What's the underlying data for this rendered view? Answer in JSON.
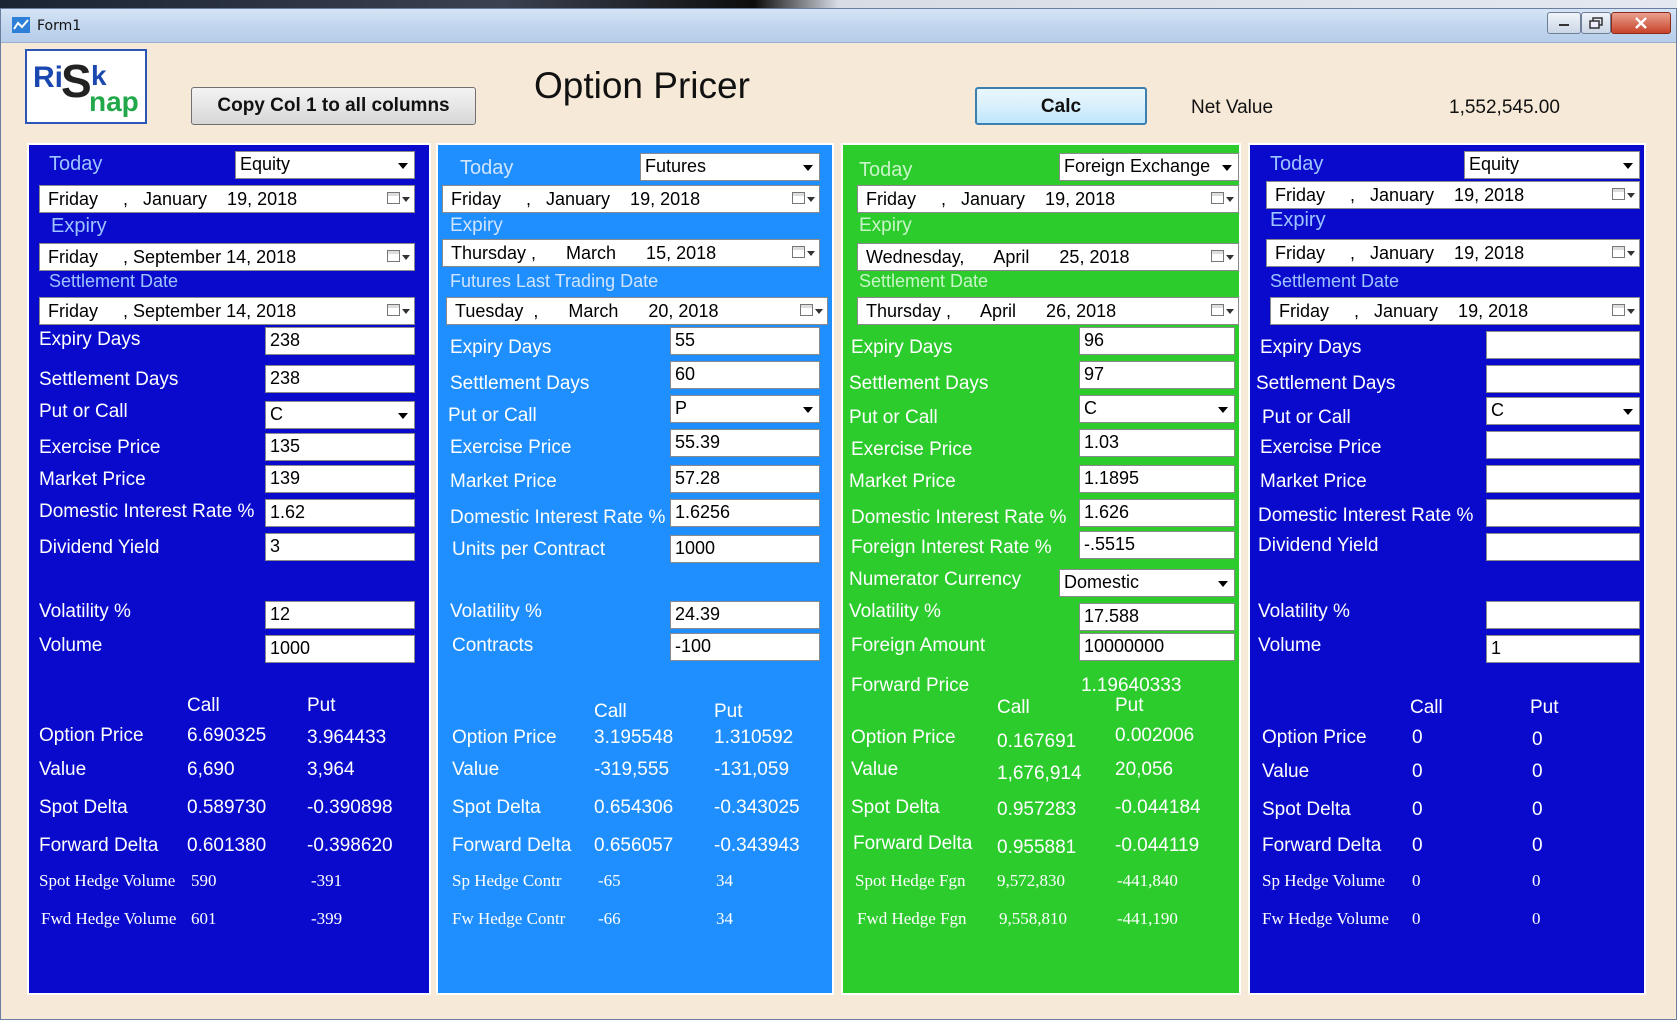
{
  "window": {
    "title": "Form1"
  },
  "header": {
    "copy_button": "Copy Col 1 to all columns",
    "title": "Option Pricer",
    "calc_button": "Calc",
    "net_value_label": "Net Value",
    "net_value": "1,552,545.00",
    "logo_text": "RiSknap"
  },
  "colors": {
    "panel1": "#0a0acc",
    "panel2": "#1f8fff",
    "panel3": "#2dcc2d",
    "panel4": "#0a0acc",
    "header_text": "#9ec4ff"
  },
  "col1": {
    "today_label": "Today",
    "instrument": "Equity",
    "today_date": "Friday     ,   January    19, 2018",
    "expiry_label": "Expiry",
    "expiry_date": "Friday     , September 14, 2018",
    "settle_label": "Settlement Date",
    "settle_date": "Friday     , September 14, 2018",
    "expiry_days_label": "Expiry Days",
    "expiry_days": "238",
    "settle_days_label": "Settlement Days",
    "settle_days": "238",
    "put_call_label": "Put or Call",
    "put_call": "C",
    "exercise_label": "Exercise Price",
    "exercise": "135",
    "market_label": "Market Price",
    "market": "139",
    "dom_rate_label": "Domestic Interest Rate %",
    "dom_rate": "1.62",
    "div_label": "Dividend Yield",
    "div": "3",
    "vol_label": "Volatility %",
    "vol": "12",
    "volume_label": "Volume",
    "volume": "1000",
    "call_hdr": "Call",
    "put_hdr": "Put",
    "opt_price_label": "Option Price",
    "opt_call": "6.690325",
    "opt_put": "3.964433",
    "value_label": "Value",
    "value_call": "6,690",
    "value_put": "3,964",
    "spot_delta_label": "Spot Delta",
    "sd_call": "0.589730",
    "sd_put": "-0.390898",
    "fwd_delta_label": "Forward Delta",
    "fd_call": "0.601380",
    "fd_put": "-0.398620",
    "spot_hedge_label": "Spot Hedge Volume",
    "sh_call": "590",
    "sh_put": "-391",
    "fwd_hedge_label": "Fwd Hedge Volume",
    "fh_call": "601",
    "fh_put": "-399"
  },
  "col2": {
    "today_label": "Today",
    "instrument": "Futures",
    "today_date": "Friday     ,   January    19, 2018",
    "expiry_label": "Expiry",
    "expiry_date": "Thursday ,      March      15, 2018",
    "settle_label": "Futures Last Trading Date",
    "settle_date": "Tuesday  ,      March      20, 2018",
    "expiry_days_label": "Expiry Days",
    "expiry_days": "55",
    "settle_days_label": "Settlement Days",
    "settle_days": "60",
    "put_call_label": "Put or Call",
    "put_call": "P",
    "exercise_label": "Exercise Price",
    "exercise": "55.39",
    "market_label": "Market Price",
    "market": "57.28",
    "dom_rate_label": "Domestic Interest Rate %",
    "dom_rate": "1.6256",
    "units_label": "Units per Contract",
    "units": "1000",
    "vol_label": "Volatility %",
    "vol": "24.39",
    "contracts_label": "Contracts",
    "contracts": "-100",
    "call_hdr": "Call",
    "put_hdr": "Put",
    "opt_price_label": "Option Price",
    "opt_call": "3.195548",
    "opt_put": "1.310592",
    "value_label": "Value",
    "value_call": "-319,555",
    "value_put": "-131,059",
    "spot_delta_label": "Spot Delta",
    "sd_call": "0.654306",
    "sd_put": "-0.343025",
    "fwd_delta_label": "Forward Delta",
    "fd_call": "0.656057",
    "fd_put": "-0.343943",
    "spot_hedge_label": "Sp Hedge Contr",
    "sh_call": "-65",
    "sh_put": "34",
    "fwd_hedge_label": "Fw Hedge Contr",
    "fh_call": "-66",
    "fh_put": "34"
  },
  "col3": {
    "today_label": "Today",
    "instrument": "Foreign Exchange",
    "today_date": "Friday     ,   January    19, 2018",
    "expiry_label": "Expiry",
    "expiry_date": "Wednesday,      April      25, 2018",
    "settle_label": "Settlement Date",
    "settle_date": "Thursday ,      April      26, 2018",
    "expiry_days_label": "Expiry Days",
    "expiry_days": "96",
    "settle_days_label": "Settlement Days",
    "settle_days": "97",
    "put_call_label": "Put or Call",
    "put_call": "C",
    "exercise_label": "Exercise Price",
    "exercise": "1.03",
    "market_label": "Market Price",
    "market": "1.1895",
    "dom_rate_label": "Domestic Interest Rate %",
    "dom_rate": "1.626",
    "for_rate_label": "Foreign Interest Rate %",
    "for_rate": "-.5515",
    "numer_label": "Numerator Currency",
    "numer": "Domestic",
    "vol_label": "Volatility %",
    "vol": "17.588",
    "foreign_amt_label": "Foreign Amount",
    "foreign_amt": "10000000",
    "fwd_price_label": "Forward Price",
    "fwd_price": "1.19640333",
    "call_hdr": "Call",
    "put_hdr": "Put",
    "opt_price_label": "Option Price",
    "opt_call": "0.167691",
    "opt_put": "0.002006",
    "value_label": "Value",
    "value_call": "1,676,914",
    "value_put": "20,056",
    "spot_delta_label": "Spot Delta",
    "sd_call": "0.957283",
    "sd_put": "-0.044184",
    "fwd_delta_label": "Forward Delta",
    "fd_call": "0.955881",
    "fd_put": "-0.044119",
    "spot_hedge_label": "Spot Hedge Fgn",
    "sh_call": "9,572,830",
    "sh_put": "-441,840",
    "fwd_hedge_label": "Fwd Hedge Fgn",
    "fh_call": "9,558,810",
    "fh_put": "-441,190"
  },
  "col4": {
    "today_label": "Today",
    "instrument": "Equity",
    "today_date": "Friday     ,   January    19, 2018",
    "expiry_label": "Expiry",
    "expiry_date": "Friday     ,   January    19, 2018",
    "settle_label": "Settlement Date",
    "settle_date": "Friday     ,   January    19, 2018",
    "expiry_days_label": "Expiry Days",
    "expiry_days": "",
    "settle_days_label": "Settlement Days",
    "settle_days": "",
    "put_call_label": "Put or Call",
    "put_call": "C",
    "exercise_label": "Exercise Price",
    "exercise": "",
    "market_label": "Market Price",
    "market": "",
    "dom_rate_label": "Domestic Interest Rate %",
    "dom_rate": "",
    "div_label": "Dividend Yield",
    "div": "",
    "vol_label": "Volatility %",
    "vol": "",
    "volume_label": "Volume",
    "volume": "1",
    "call_hdr": "Call",
    "put_hdr": "Put",
    "opt_price_label": "Option Price",
    "opt_call": "0",
    "opt_put": "0",
    "value_label": "Value",
    "value_call": "0",
    "value_put": "0",
    "spot_delta_label": "Spot Delta",
    "sd_call": "0",
    "sd_put": "0",
    "fwd_delta_label": "Forward Delta",
    "fd_call": "0",
    "fd_put": "0",
    "spot_hedge_label": "Sp Hedge Volume",
    "sh_call": "0",
    "sh_put": "0",
    "fwd_hedge_label": "Fw Hedge Volume",
    "fh_call": "0",
    "fh_put": "0"
  }
}
